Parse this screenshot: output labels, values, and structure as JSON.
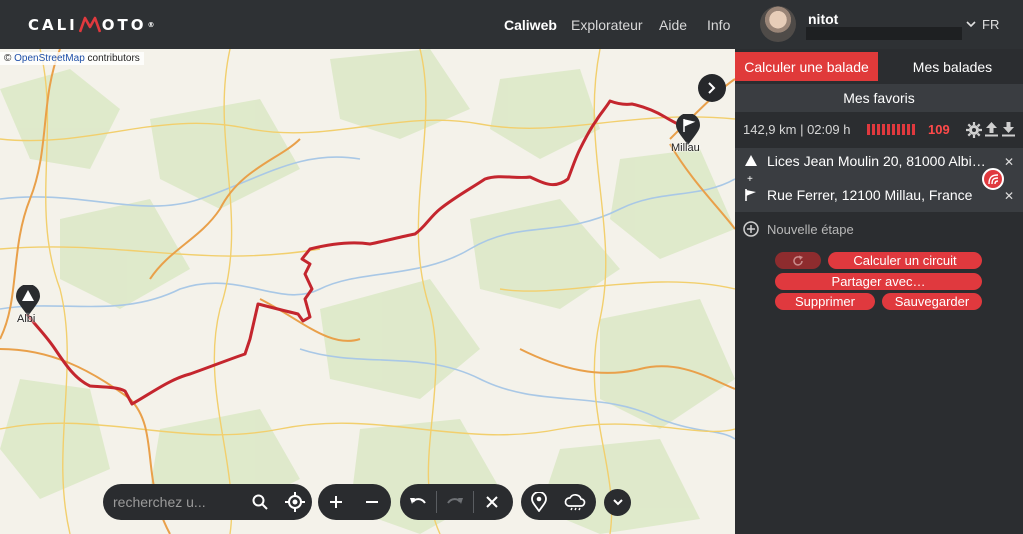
{
  "header": {
    "logo_left": "CALI",
    "logo_right": "OTO",
    "logo_mark": "®",
    "nav": [
      "Caliweb",
      "Explorateur",
      "Aide",
      "Info"
    ],
    "username": "nitot",
    "language": "FR"
  },
  "map": {
    "attribution_prefix": "© ",
    "attribution_link": "OpenStreetMap",
    "attribution_suffix": " contributors",
    "start_label": "Albi",
    "end_label": "Millau",
    "search_placeholder": "recherchez u..."
  },
  "panel": {
    "tab_calculate": "Calculer une balade",
    "tab_rides": "Mes balades",
    "favorites": "Mes favoris",
    "stats": "142,9 km | 02:09 h",
    "score": "109",
    "score_bars": 10,
    "start_address": "Lices Jean Moulin 20, 81000 Albi…",
    "end_address": "Rue Ferrer, 12100 Millau, France",
    "new_step": "Nouvelle étape",
    "btn_circuit": "Calculer un circuit",
    "btn_share": "Partager avec…",
    "btn_delete": "Supprimer",
    "btn_save": "Sauvegarder"
  },
  "colors": {
    "accent": "#e03a3a",
    "route": "#c4262e",
    "panel_bg": "#2b2d30"
  },
  "icons": [
    "logo-pin-icon",
    "chevron-down-icon",
    "chevron-right-icon",
    "search-icon",
    "locate-icon",
    "zoom-in-icon",
    "zoom-out-icon",
    "undo-icon",
    "redo-icon",
    "clear-icon",
    "poi-icon",
    "weather-icon",
    "settings-icon",
    "upload-icon",
    "download-icon",
    "start-triangle-icon",
    "finish-flag-icon",
    "road-badge-icon",
    "add-step-icon",
    "refresh-icon"
  ]
}
